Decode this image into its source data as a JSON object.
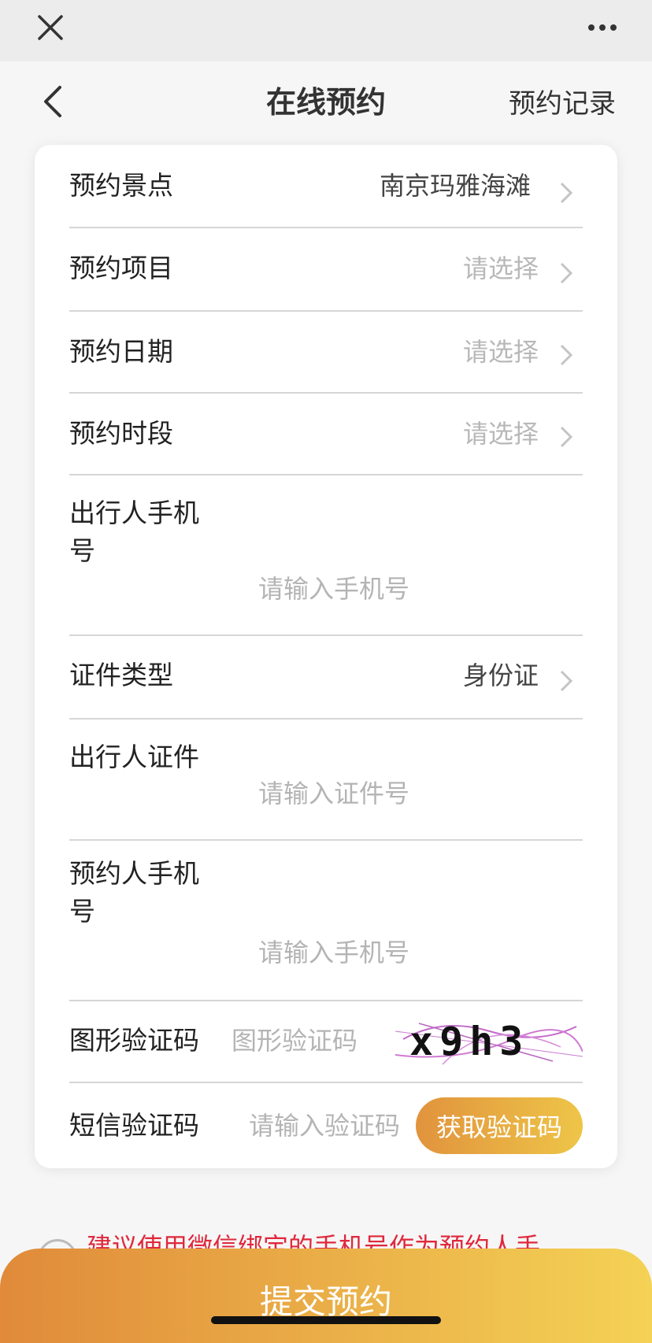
{
  "header": {
    "title": "在线预约",
    "records_label": "预约记录"
  },
  "form": {
    "attraction": {
      "label": "预约景点",
      "value": "南京玛雅海滩"
    },
    "item": {
      "label": "预约项目",
      "placeholder": "请选择"
    },
    "date": {
      "label": "预约日期",
      "placeholder": "请选择"
    },
    "timeslot": {
      "label": "预约时段",
      "placeholder": "请选择"
    },
    "traveler_phone": {
      "label_line1": "出行人手机",
      "label_line2": "号",
      "placeholder": "请输入手机号"
    },
    "id_type": {
      "label": "证件类型",
      "value": "身份证"
    },
    "traveler_id": {
      "label": "出行人证件",
      "placeholder": "请输入证件号"
    },
    "booker_phone": {
      "label_line1": "预约人手机",
      "label_line2": "号",
      "placeholder": "请输入手机号"
    },
    "image_captcha": {
      "label": "图形验证码",
      "placeholder": "图形验证码",
      "captcha_text": "x9h3"
    },
    "sms_code": {
      "label": "短信验证码",
      "placeholder": "请输入验证码",
      "button": "获取验证码"
    }
  },
  "notice": {
    "text": "建议使用微信绑定的手机号作为预约人手"
  },
  "submit_label": "提交预约",
  "colors": {
    "accent_start": "#e08a3a",
    "accent_end": "#f4d255",
    "warning": "#e0283c",
    "placeholder": "#b4b4b4"
  },
  "icons": {
    "close": "close-icon",
    "more": "more-icon",
    "back": "back-arrow-icon",
    "chevron": "chevron-right-icon"
  }
}
